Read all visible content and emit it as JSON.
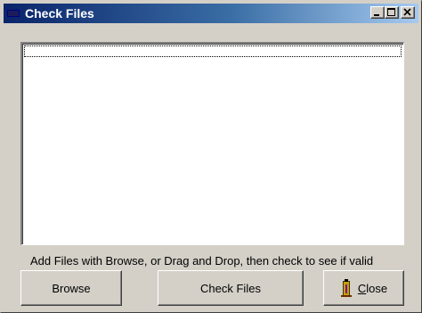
{
  "window": {
    "title": "Check Files",
    "title_icon": "app-icon",
    "controls": [
      "minimize-icon",
      "maximize-icon",
      "close-icon"
    ],
    "title_gradient": [
      "#0a246a",
      "#a6caf0"
    ]
  },
  "file_list": {
    "items": []
  },
  "hint_text": "Add Files with Browse, or Drag and Drop, then check to see if valid",
  "buttons": {
    "browse": "Browse",
    "check_files": "Check Files",
    "close": "Close",
    "close_mnemonic": "C",
    "close_rest": "lose",
    "close_icon": "door-exit-icon"
  }
}
